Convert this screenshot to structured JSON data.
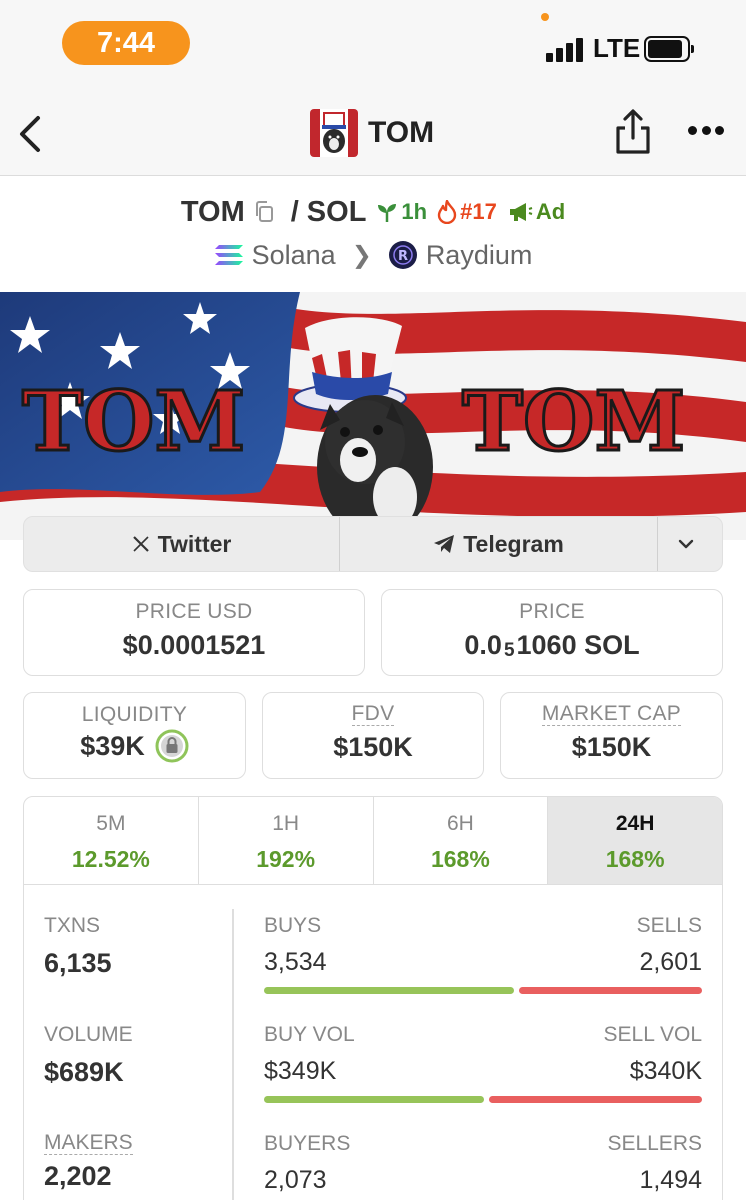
{
  "status_bar": {
    "time": "7:44",
    "network": "LTE"
  },
  "nav": {
    "title": "TOM"
  },
  "pair": {
    "base": "TOM",
    "separator": "/",
    "quote": "SOL",
    "age_badge": "1h",
    "rank_badge": "#17",
    "ad_badge": "Ad",
    "chain": "Solana",
    "dex": "Raydium"
  },
  "banner": {
    "left_text": "TOM",
    "right_text": "TOM"
  },
  "social": {
    "twitter_label": "Twitter",
    "telegram_label": "Telegram"
  },
  "prices": {
    "price_usd_label": "PRICE USD",
    "price_usd": "$0.0001521",
    "price_label": "PRICE",
    "price_sol_prefix": "0.0",
    "price_sol_zeros": "5",
    "price_sol_suffix": "1060 SOL"
  },
  "metrics": {
    "liquidity_label": "LIQUIDITY",
    "liquidity": "$39K",
    "fdv_label": "FDV",
    "fdv": "$150K",
    "mcap_label": "MARKET CAP",
    "mcap": "$150K"
  },
  "timeframes": [
    {
      "label": "5M",
      "change": "12.52%"
    },
    {
      "label": "1H",
      "change": "192%"
    },
    {
      "label": "6H",
      "change": "168%"
    },
    {
      "label": "24H",
      "change": "168%"
    }
  ],
  "active_timeframe": "24H",
  "stats": {
    "txns_label": "TXNS",
    "txns": "6,135",
    "buys_label": "BUYS",
    "buys": "3,534",
    "sells_label": "SELLS",
    "sells": "2,601",
    "volume_label": "VOLUME",
    "volume": "$689K",
    "buy_vol_label": "BUY VOL",
    "buy_vol": "$349K",
    "sell_vol_label": "SELL VOL",
    "sell_vol": "$340K",
    "makers_label": "MAKERS",
    "makers": "2,202",
    "buyers_label": "BUYERS",
    "buyers": "2,073",
    "sellers_label": "SELLERS",
    "sellers": "1,494",
    "buy_share_txns": 0.576,
    "buy_share_vol": 0.506
  },
  "colors": {
    "accent_orange": "#f7941d",
    "positive_green": "#5c9a2c",
    "buy_bar": "#97c459",
    "sell_bar": "#e95f5f",
    "rank_red": "#e8471e"
  },
  "icons": {
    "back": "chevron-left-icon",
    "share": "share-icon",
    "more": "more-icon",
    "copy": "copy-icon",
    "age": "sprout-icon",
    "rank": "flame-icon",
    "ad": "megaphone-icon",
    "chain": "solana-icon",
    "dex": "raydium-icon",
    "twitter": "x-logo-icon",
    "telegram": "telegram-icon",
    "dropdown": "chevron-down-icon",
    "lock": "lock-icon"
  }
}
